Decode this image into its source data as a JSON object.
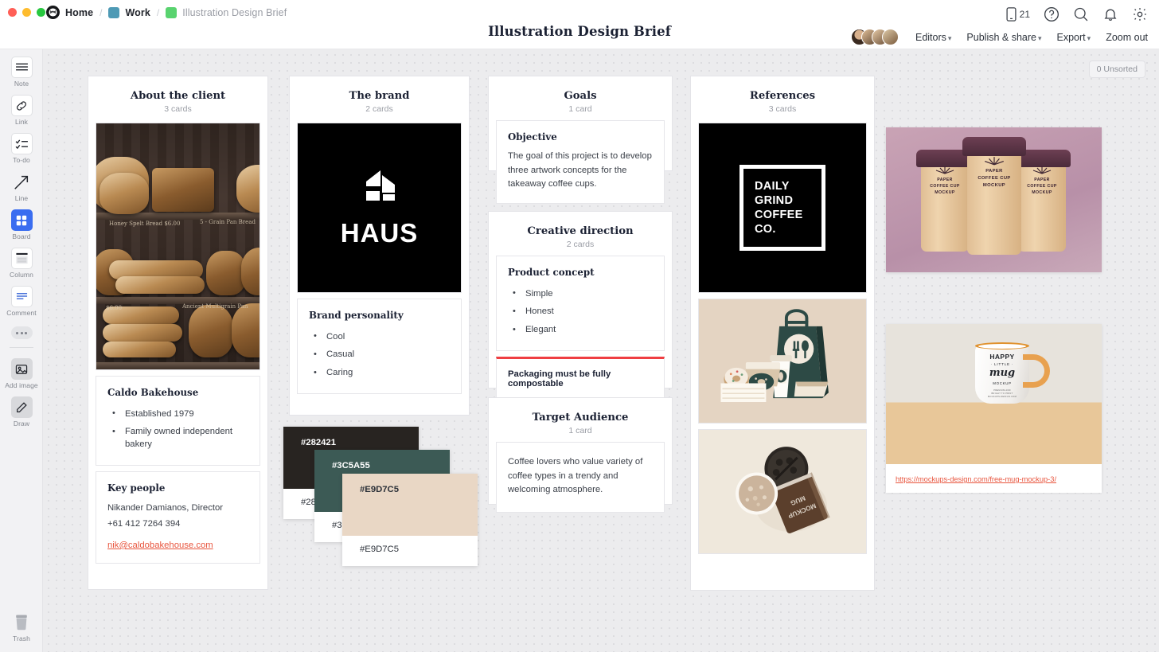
{
  "window": {
    "breadcrumb": [
      {
        "label": "Home",
        "icon": "milanote-logo-icon",
        "muted": false
      },
      {
        "label": "Work",
        "icon": "teal-square-icon",
        "muted": false
      },
      {
        "label": "Illustration Design Brief",
        "icon": "green-square-icon",
        "muted": true
      }
    ],
    "title": "Illustration Design Brief"
  },
  "topbar": {
    "device_count": "21",
    "icons": [
      "phone-icon",
      "help-icon",
      "search-icon",
      "bell-icon",
      "gear-icon"
    ],
    "menu": [
      {
        "label": "Editors",
        "caret": true
      },
      {
        "label": "Publish & share",
        "caret": true
      },
      {
        "label": "Export",
        "caret": true
      },
      {
        "label": "Zoom out",
        "caret": false
      }
    ]
  },
  "toolbar": {
    "tools": [
      {
        "label": "Note",
        "icon": "note-icon"
      },
      {
        "label": "Link",
        "icon": "link-icon"
      },
      {
        "label": "To-do",
        "icon": "todo-icon"
      },
      {
        "label": "Line",
        "icon": "line-arrow-icon"
      },
      {
        "label": "Board",
        "icon": "board-icon"
      },
      {
        "label": "Column",
        "icon": "column-icon"
      },
      {
        "label": "Comment",
        "icon": "comment-icon"
      }
    ],
    "more_label": "more-options",
    "extra": [
      {
        "label": "Add image",
        "icon": "add-image-icon"
      },
      {
        "label": "Draw",
        "icon": "pencil-icon"
      }
    ],
    "trash": {
      "label": "Trash",
      "icon": "trash-icon"
    }
  },
  "canvas": {
    "unsorted_badge": "0 Unsorted"
  },
  "columns": [
    {
      "title": "About the client",
      "subtitle": "3 cards",
      "cards": [
        {
          "type": "image",
          "name": "bakery-photo"
        },
        {
          "type": "text",
          "heading": "Caldo Bakehouse",
          "bullets": [
            "Established 1979",
            "Family owned independent bakery"
          ]
        },
        {
          "type": "contact",
          "heading": "Key people",
          "lines": [
            "Nikander Damianos, Director",
            "+61 412 7264 394"
          ],
          "email": "nik@caldobakehouse.com"
        }
      ]
    },
    {
      "title": "The brand",
      "subtitle": "2 cards",
      "cards": [
        {
          "type": "image",
          "name": "haus-logo",
          "wordmark": "HAUS"
        },
        {
          "type": "text",
          "heading": "Brand personality",
          "bullets": [
            "Cool",
            "Casual",
            "Caring"
          ]
        }
      ]
    },
    {
      "title": "Goals",
      "subtitle": "1 card",
      "cards": [
        {
          "type": "text",
          "heading": "Objective",
          "body": "The goal of this project is to develop three artwork concepts for the takeaway coffee cups."
        }
      ]
    },
    {
      "title": "Creative direction",
      "subtitle": "2 cards",
      "cards": [
        {
          "type": "text",
          "heading": "Product concept",
          "bullets": [
            "Simple",
            "Honest",
            "Elegant"
          ]
        },
        {
          "type": "highlight",
          "accent": "#ef3e42",
          "body": "Packaging must be fully compostable"
        }
      ]
    },
    {
      "title": "Target Audience",
      "subtitle": "1 card",
      "cards": [
        {
          "type": "text",
          "body": "Coffee lovers who value variety of coffee types in a trendy and welcoming atmosphere."
        }
      ]
    },
    {
      "title": "References",
      "subtitle": "3 cards",
      "cards": [
        {
          "type": "image",
          "name": "daily-grind-logo",
          "lines": [
            "DAILY",
            "GRIND",
            "COFFEE",
            "CO."
          ]
        },
        {
          "type": "image",
          "name": "takeaway-packaging-illustration"
        },
        {
          "type": "image",
          "name": "mug-mockup-photo"
        }
      ]
    }
  ],
  "swatches": [
    {
      "hex": "#282421",
      "label": "#282421"
    },
    {
      "hex": "#3C5A55",
      "label": "#3C5A55"
    },
    {
      "hex": "#E9D7C5",
      "label": "#E9D7C5"
    }
  ],
  "floating_images": [
    {
      "name": "paper-coffee-cup-mockup",
      "cup_text": [
        "PAPER",
        "COFFEE CUP",
        "MOCKUP"
      ]
    },
    {
      "name": "happy-little-mug-mockup",
      "mug_text": [
        "HAPPY",
        "· LITTLE ·",
        "mug",
        "MOCKUP"
      ],
      "link": "https://mockups-design.com/free-mug-mockup-3/"
    }
  ]
}
